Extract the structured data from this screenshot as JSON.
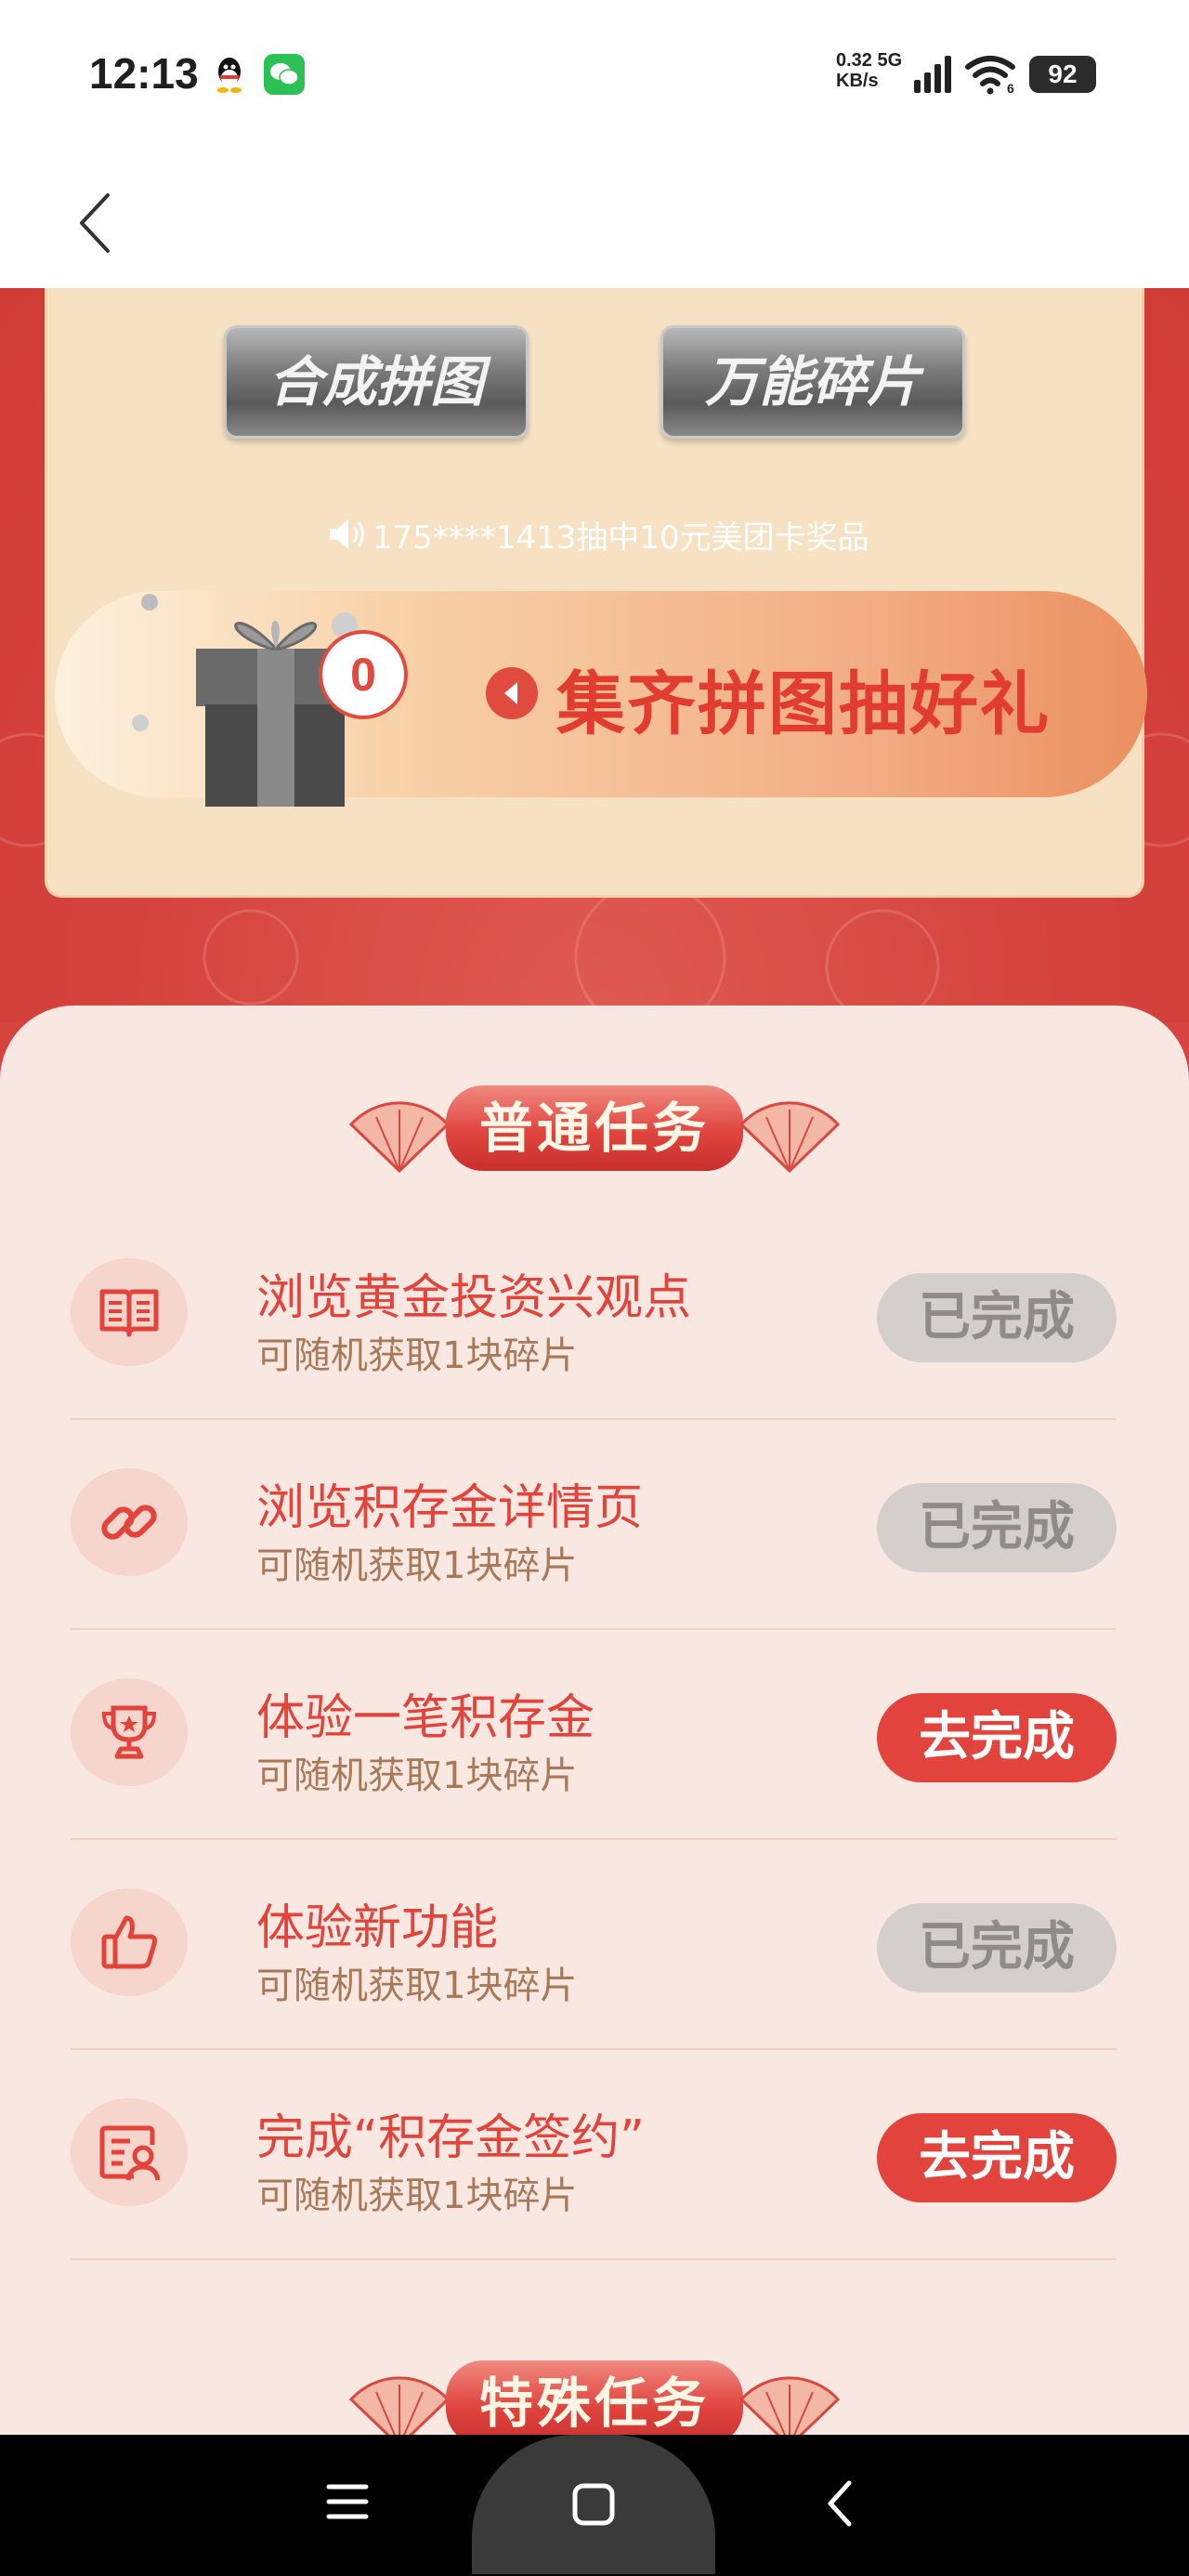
{
  "status_bar": {
    "time": "12:13",
    "net_speed_value": "0.32",
    "net_speed_type": "5G",
    "net_speed_unit": "KB/s",
    "wifi_label": "6",
    "battery": "92",
    "icons": [
      "qq-icon",
      "wechat-icon",
      "signal-icon",
      "wifi-icon",
      "battery-icon"
    ]
  },
  "header": {
    "back_icon": "chevron-left-icon"
  },
  "puzzle": {
    "combine_label": "合成拼图",
    "universal_label": "万能碎片",
    "marquee_text": "175****1413抽中10元美团卡奖品",
    "count": "0",
    "draw_label": "集齐拼图抽好礼"
  },
  "sections": {
    "normal_title": "普通任务",
    "special_title": "特殊任务"
  },
  "tasks": [
    {
      "title": "浏览黄金投资兴观点",
      "subtitle": "可随机获取1块碎片",
      "button": "已完成",
      "state": "done",
      "icon": "book-icon"
    },
    {
      "title": "浏览积存金详情页",
      "subtitle": "可随机获取1块碎片",
      "button": "已完成",
      "state": "done",
      "icon": "link-icon"
    },
    {
      "title": "体验一笔积存金",
      "subtitle": "可随机获取1块碎片",
      "button": "去完成",
      "state": "todo",
      "icon": "trophy-icon"
    },
    {
      "title": "体验新功能",
      "subtitle": "可随机获取1块碎片",
      "button": "已完成",
      "state": "done",
      "icon": "thumbs-up-icon"
    },
    {
      "title": "完成“积存金签约”",
      "subtitle": "可随机获取1块碎片",
      "button": "去完成",
      "state": "todo",
      "icon": "user-card-icon"
    }
  ],
  "colors": {
    "accent_red": "#e2443d",
    "page_red": "#d7443f",
    "card_cream": "#f6e2c3",
    "panel_pink": "#f9e8e2",
    "done_gray": "#d4cfcc",
    "subtitle_brown": "#a77958"
  },
  "nav_bar": {
    "icons": [
      "menu-icon",
      "home-icon",
      "back-icon"
    ]
  }
}
